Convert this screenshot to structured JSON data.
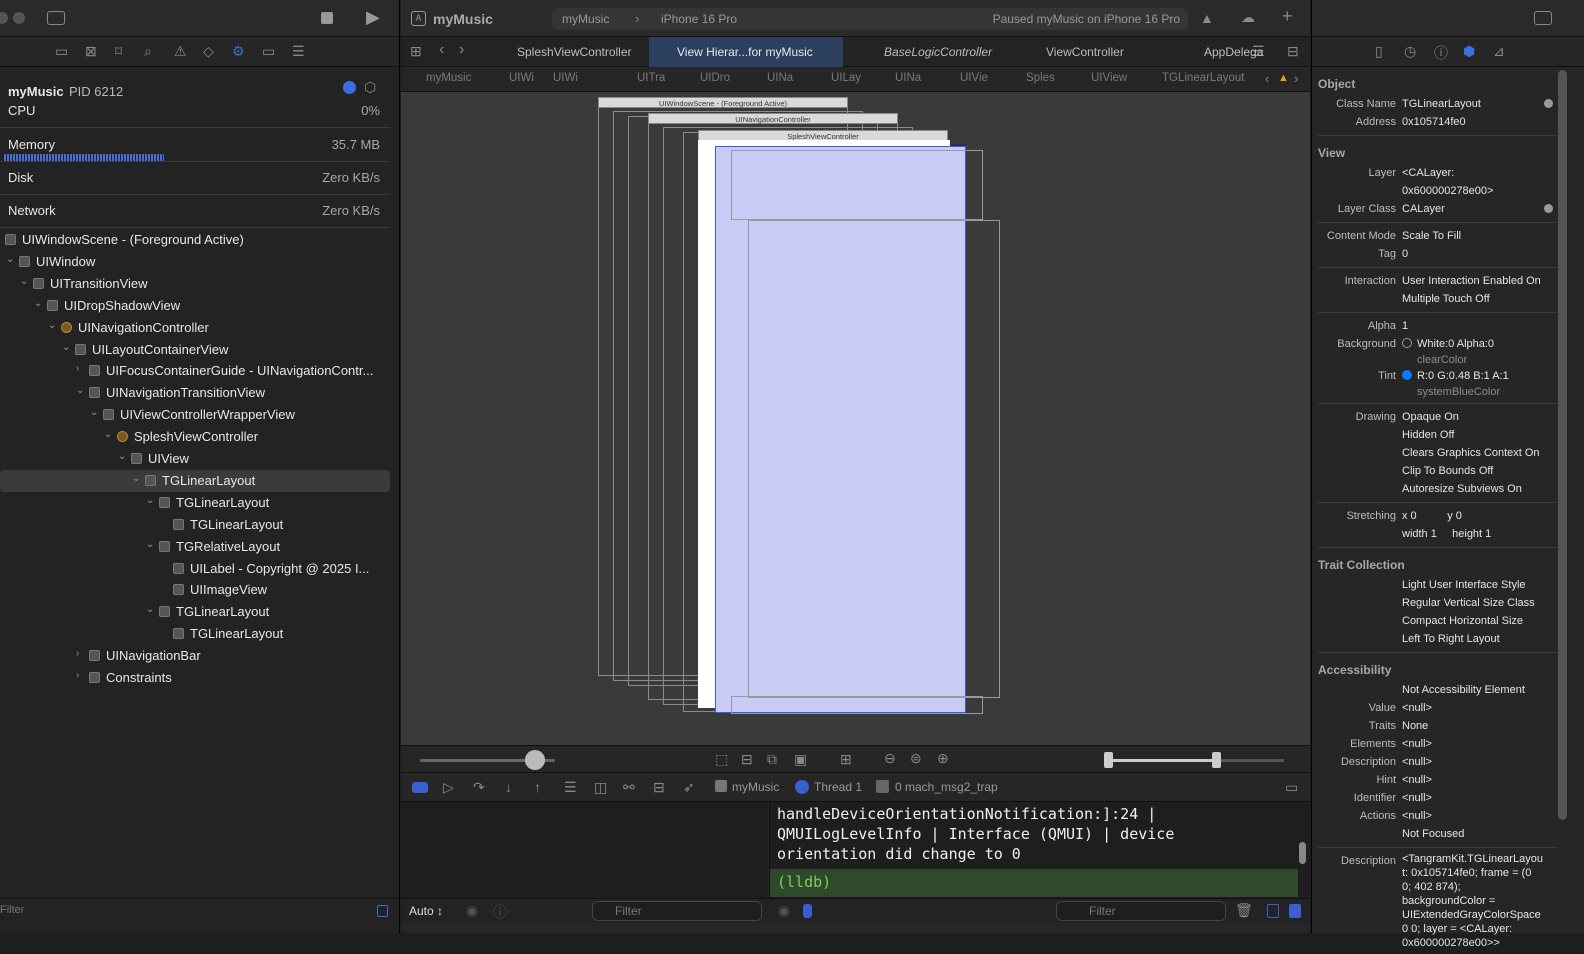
{
  "left": {
    "gauges": {
      "process_name": "myMusic",
      "pid": "PID 6212",
      "cpu_label": "CPU",
      "cpu_value": "0%",
      "memory_label": "Memory",
      "memory_value": "35.7 MB",
      "memory_fill": 0.41,
      "disk_label": "Disk",
      "disk_value": "Zero KB/s",
      "network_label": "Network",
      "network_value": "Zero KB/s"
    },
    "tree": [
      {
        "label": "UIWindowScene - (Foreground Active)",
        "level": -1,
        "chev": "",
        "icon": "scene"
      },
      {
        "label": "UIWindow",
        "level": 0,
        "chev": "open",
        "icon": "view"
      },
      {
        "label": "UITransitionView",
        "level": 1,
        "chev": "open",
        "icon": "view"
      },
      {
        "label": "UIDropShadowView",
        "level": 2,
        "chev": "open",
        "icon": "view"
      },
      {
        "label": "UINavigationController",
        "level": 3,
        "chev": "open",
        "icon": "vc"
      },
      {
        "label": "UILayoutContainerView",
        "level": 4,
        "chev": "open",
        "icon": "view"
      },
      {
        "label": "UIFocusContainerGuide - UINavigationContr...",
        "level": 5,
        "chev": "closed",
        "icon": "view"
      },
      {
        "label": "UINavigationTransitionView",
        "level": 5,
        "chev": "open",
        "icon": "view"
      },
      {
        "label": "UIViewControllerWrapperView",
        "level": 6,
        "chev": "open",
        "icon": "view"
      },
      {
        "label": "SpleshViewController",
        "level": 7,
        "chev": "open",
        "icon": "vc"
      },
      {
        "label": "UIView",
        "level": 8,
        "chev": "open",
        "icon": "view"
      },
      {
        "label": "TGLinearLayout",
        "level": 9,
        "chev": "open",
        "icon": "view",
        "selected": true
      },
      {
        "label": "TGLinearLayout",
        "level": 10,
        "chev": "open",
        "icon": "view"
      },
      {
        "label": "TGLinearLayout",
        "level": 11,
        "chev": "",
        "icon": "view"
      },
      {
        "label": "TGRelativeLayout",
        "level": 10,
        "chev": "open",
        "icon": "view"
      },
      {
        "label": "UILabel - Copyright @ 2025 I...",
        "level": 11,
        "chev": "",
        "icon": "label"
      },
      {
        "label": "UIImageView",
        "level": 11,
        "chev": "",
        "icon": "image"
      },
      {
        "label": "TGLinearLayout",
        "level": 10,
        "chev": "open",
        "icon": "view"
      },
      {
        "label": "TGLinearLayout",
        "level": 11,
        "chev": "",
        "icon": "view"
      },
      {
        "label": "UINavigationBar",
        "level": 5,
        "chev": "closed",
        "icon": "view"
      },
      {
        "label": "Constraints",
        "level": 5,
        "chev": "closed",
        "icon": "constraints"
      }
    ],
    "filter_placeholder": "Filter"
  },
  "center": {
    "scheme_title": "myMusic",
    "scheme": "myMusic",
    "device": "iPhone 16 Pro",
    "status": "Paused myMusic on iPhone 16 Pro",
    "tabs": [
      "SpleshViewController",
      "View Hierar...for myMusic",
      "BaseLogicController",
      "ViewController",
      "AppDelega"
    ],
    "active_tab": 1,
    "breadcrumb": [
      "myMusic",
      "UIWi",
      "UIWi",
      "UITra",
      "UIDro",
      "UINa",
      "UILay",
      "UINa",
      "UIVie",
      "Sples",
      "UIView",
      "TGLinearLayout"
    ],
    "canvas": {
      "scene_header": "UIWindowScene - (Foreground Active)",
      "nav_header": "UINavigationController",
      "vc_header": "SpleshViewController",
      "spacing_slider": 0.85,
      "range_low": 0.0,
      "range_high": 0.6
    },
    "debug_bar": {
      "process": "myMusic",
      "thread": "Thread 1",
      "frame": "0 mach_msg2_trap"
    },
    "console": {
      "lines": [
        "handleDeviceOrientationNotification:]:24 |",
        "QMUILogLevelInfo | Interface (QMUI) | device",
        "orientation did change to 0"
      ],
      "prompt": "(lldb)"
    },
    "variables_scope": "Auto ↕",
    "filter_placeholder": "Filter"
  },
  "inspector": {
    "sections": [
      {
        "title": "Object",
        "rows": [
          {
            "label": "Class Name",
            "val": [
              "TGLinearLayout"
            ],
            "arrow": true
          },
          {
            "label": "Address",
            "val": [
              "0x105714fe0"
            ]
          }
        ]
      },
      {
        "title": "View",
        "rows": [
          {
            "label": "Layer",
            "val": [
              "<CALayer:",
              "0x600000278e00>"
            ]
          },
          {
            "label": "Layer Class",
            "val": [
              "CALayer"
            ],
            "arrow": true
          }
        ]
      },
      {
        "title": "",
        "rows": [
          {
            "label": "Content Mode",
            "val": [
              "Scale To Fill"
            ]
          },
          {
            "label": "Tag",
            "val": [
              "0"
            ]
          }
        ]
      },
      {
        "title": "",
        "rows": [
          {
            "label": "Interaction",
            "val": [
              "User Interaction Enabled On",
              "Multiple Touch Off"
            ]
          }
        ]
      },
      {
        "title": "",
        "rows": [
          {
            "label": "Alpha",
            "val": [
              "1"
            ]
          },
          {
            "label": "Background",
            "val": [
              "White:0 Alpha:0"
            ],
            "sub": "clearColor",
            "swatch": "clear"
          },
          {
            "label": "Tint",
            "val": [
              "R:0 G:0.48 B:1 A:1"
            ],
            "sub": "systemBlueColor",
            "swatch": "#0a7aff"
          }
        ]
      },
      {
        "title": "",
        "rows": [
          {
            "label": "Drawing",
            "val": [
              "Opaque On",
              "Hidden Off",
              "Clears Graphics Context On",
              "Clip To Bounds Off",
              "Autoresize Subviews On"
            ]
          }
        ]
      },
      {
        "title": "",
        "rows": [
          {
            "label": "Stretching",
            "val": [
              "x 0          y 0",
              "width 1     height 1"
            ]
          }
        ]
      },
      {
        "title": "Trait Collection",
        "rows": [
          {
            "label": "",
            "val": [
              "Light User Interface Style",
              "Regular Vertical Size Class",
              "Compact Horizontal Size",
              "Left To Right Layout"
            ]
          }
        ]
      },
      {
        "title": "Accessibility",
        "rows": [
          {
            "label": "",
            "val": [
              "Not Accessibility Element"
            ]
          },
          {
            "label": "Value",
            "val": [
              "<null>"
            ]
          },
          {
            "label": "Traits",
            "val": [
              "None"
            ]
          },
          {
            "label": "Elements",
            "val": [
              "<null>"
            ]
          },
          {
            "label": "Description",
            "val": [
              "<null>"
            ]
          },
          {
            "label": "Hint",
            "val": [
              "<null>"
            ]
          },
          {
            "label": "Identifier",
            "val": [
              "<null>"
            ]
          },
          {
            "label": "Actions",
            "val": [
              "<null>"
            ]
          },
          {
            "label": "",
            "val": [
              "Not Focused"
            ]
          }
        ]
      },
      {
        "title": "",
        "rows": [
          {
            "label": "Description",
            "val": [
              "<TangramKit.TGLinearLayou",
              "t: 0x105714fe0; frame = (0",
              "0; 402 874);",
              "backgroundColor =",
              "UIExtendedGrayColorSpace",
              "0 0; layer = <CALayer:",
              "0x600000278e00>>"
            ]
          }
        ]
      }
    ]
  },
  "colors": {
    "accent": "#0a7aff",
    "selection_fill": "#c8cbf5",
    "console_prompt_bg": "#2f4a2a",
    "console_prompt": "#7fcf5a"
  }
}
